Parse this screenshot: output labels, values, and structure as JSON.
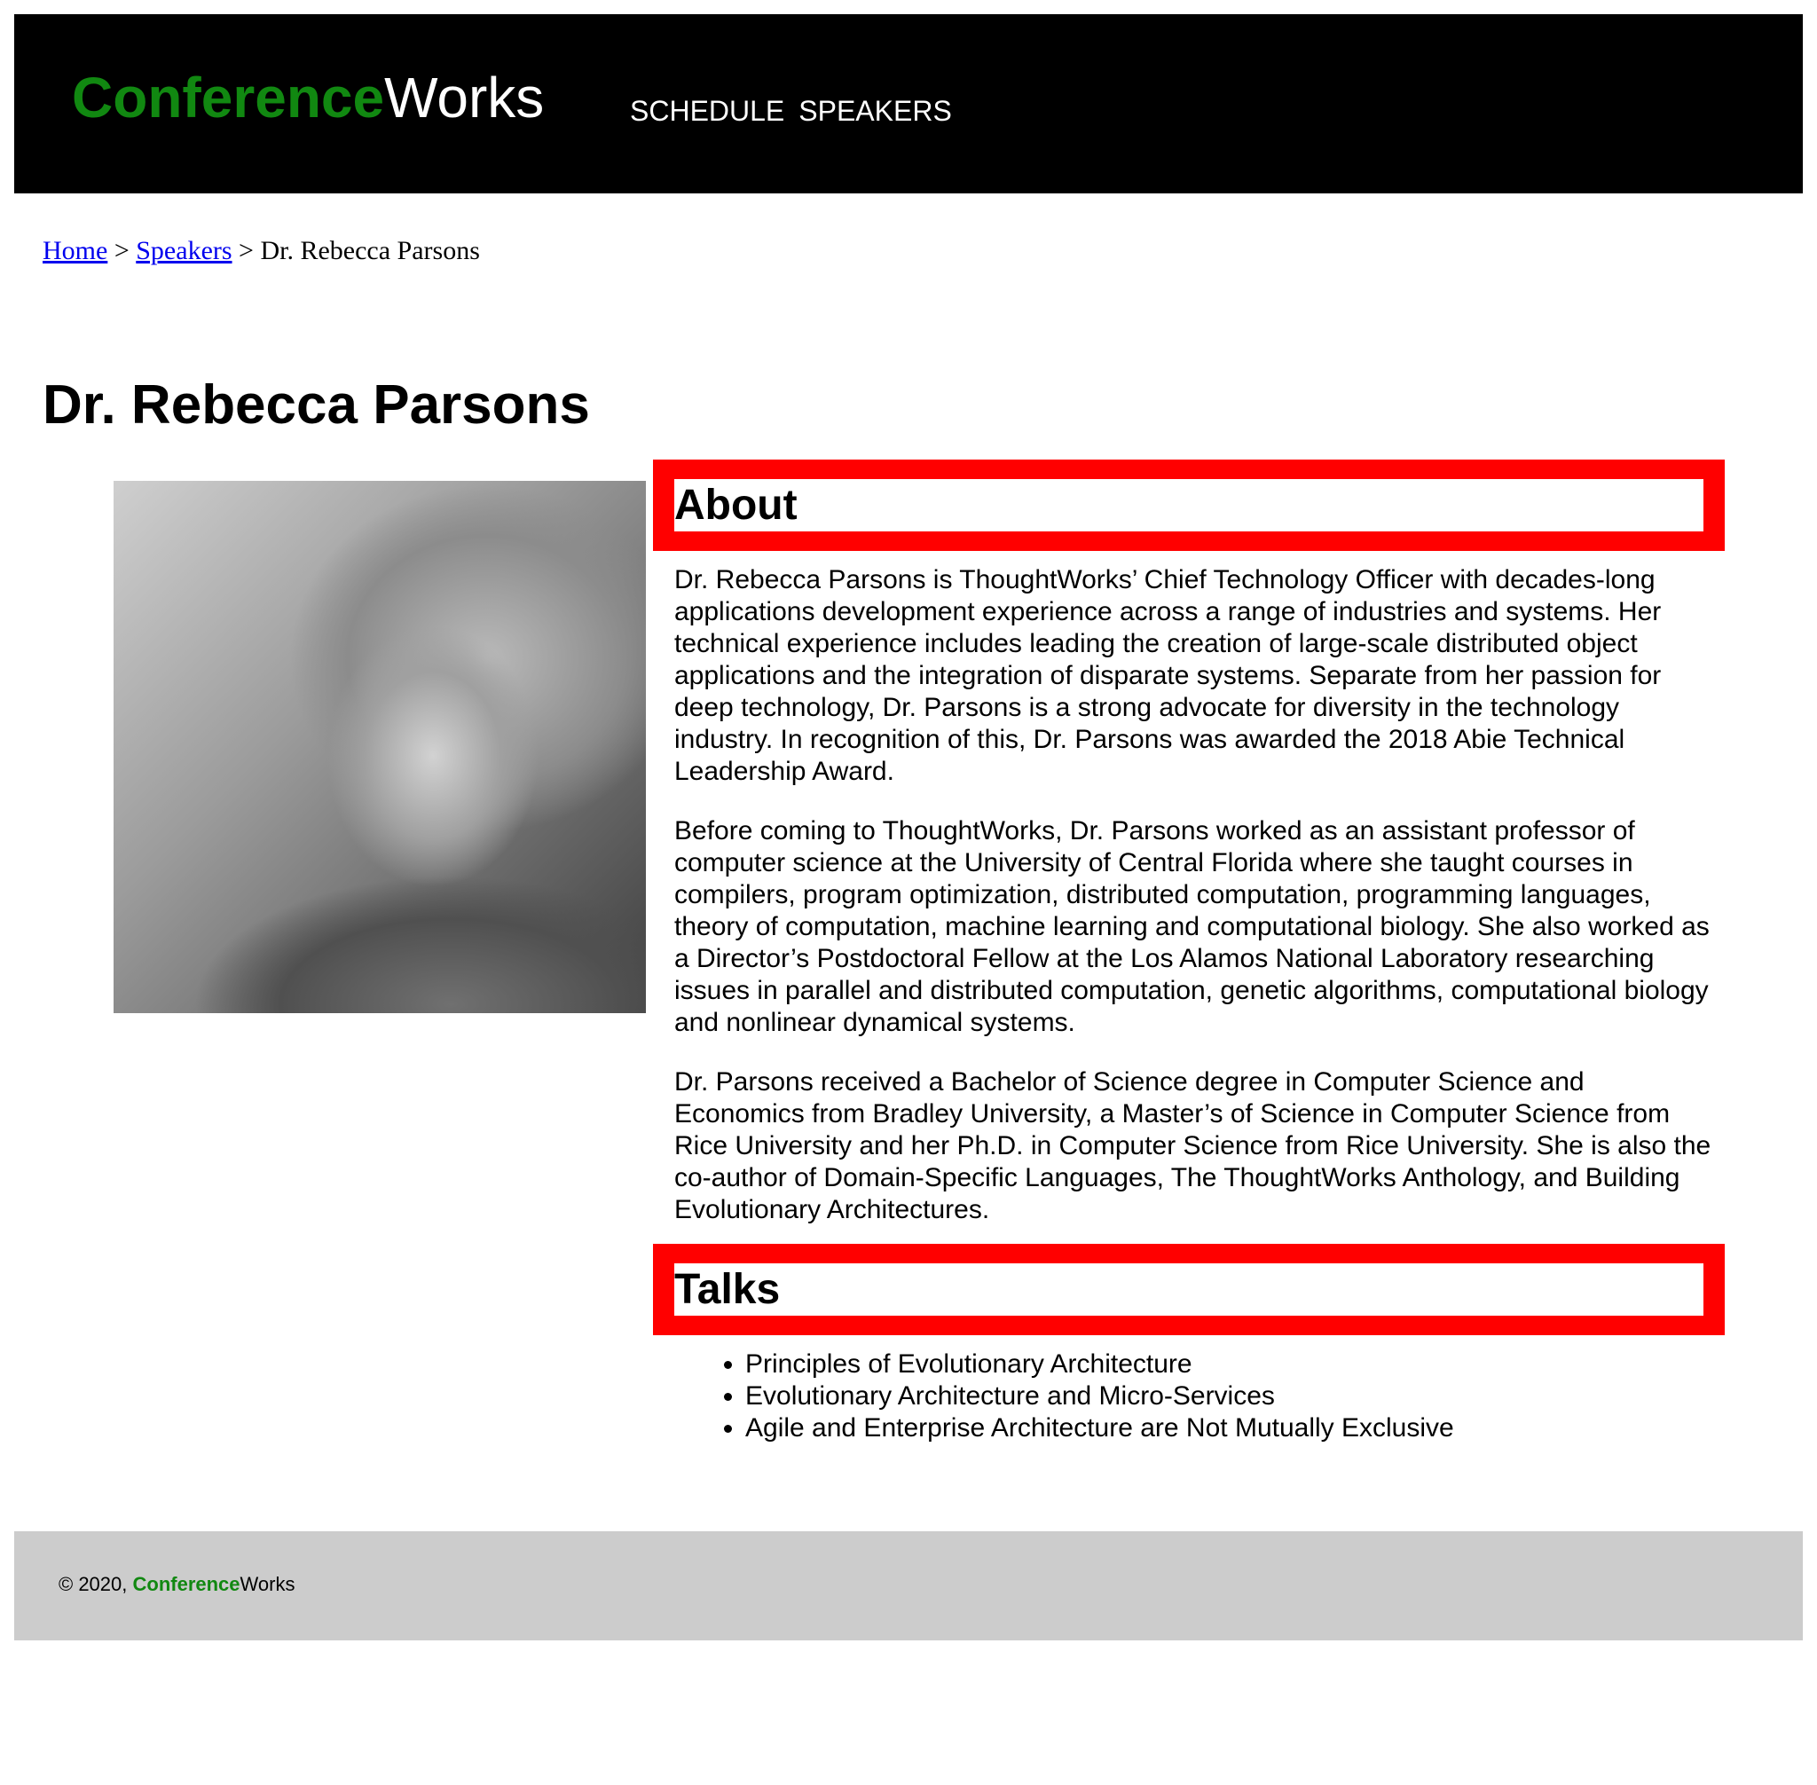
{
  "brand": {
    "primary": "Conference",
    "secondary": "Works",
    "primary_color": "#118811"
  },
  "nav": {
    "schedule": "SCHEDULE",
    "speakers": "SPEAKERS"
  },
  "breadcrumb": {
    "home": "Home",
    "sep1": " > ",
    "speakers": "Speakers",
    "sep2": " > ",
    "current": "Dr. Rebecca Parsons"
  },
  "page": {
    "title": "Dr. Rebecca Parsons"
  },
  "about": {
    "heading": "About",
    "paragraphs": [
      "Dr. Rebecca Parsons is ThoughtWorks’ Chief Technology Officer with decades-long applications development experience across a range of industries and systems. Her technical experience includes leading the creation of large-scale distributed object applications and the integration of disparate systems. Separate from her passion for deep technology, Dr. Parsons is a strong advocate for diversity in the technology industry. In recognition of this, Dr. Parsons was awarded the 2018 Abie Technical Leadership Award.",
      "Before coming to ThoughtWorks, Dr. Parsons worked as an assistant professor of computer science at the University of Central Florida where she taught courses in compilers, program optimization, distributed computation, programming languages, theory of computation, machine learning and computational biology. She also worked as a Director’s Postdoctoral Fellow at the Los Alamos National Laboratory researching issues in parallel and distributed computation, genetic algorithms, computational biology and nonlinear dynamical systems.",
      "Dr. Parsons received a Bachelor of Science degree in Computer Science and Economics from Bradley University, a Master’s of Science in Computer Science from Rice University and her Ph.D. in Computer Science from Rice University. She is also the co-author of Domain-Specific Languages, The ThoughtWorks Anthology, and Building Evolutionary Architectures."
    ]
  },
  "talks": {
    "heading": "Talks",
    "items": [
      "Principles of Evolutionary Architecture",
      "Evolutionary Architecture and Micro-Services",
      "Agile and Enterprise Architecture are Not Mutually Exclusive"
    ]
  },
  "footer": {
    "copyright": "© 2020, ",
    "brand_primary": "Conference",
    "brand_secondary": "Works"
  },
  "colors": {
    "header_bg": "#000000",
    "section_border": "#ff0000",
    "footer_bg": "#cccccc",
    "link": "#0000ee"
  }
}
